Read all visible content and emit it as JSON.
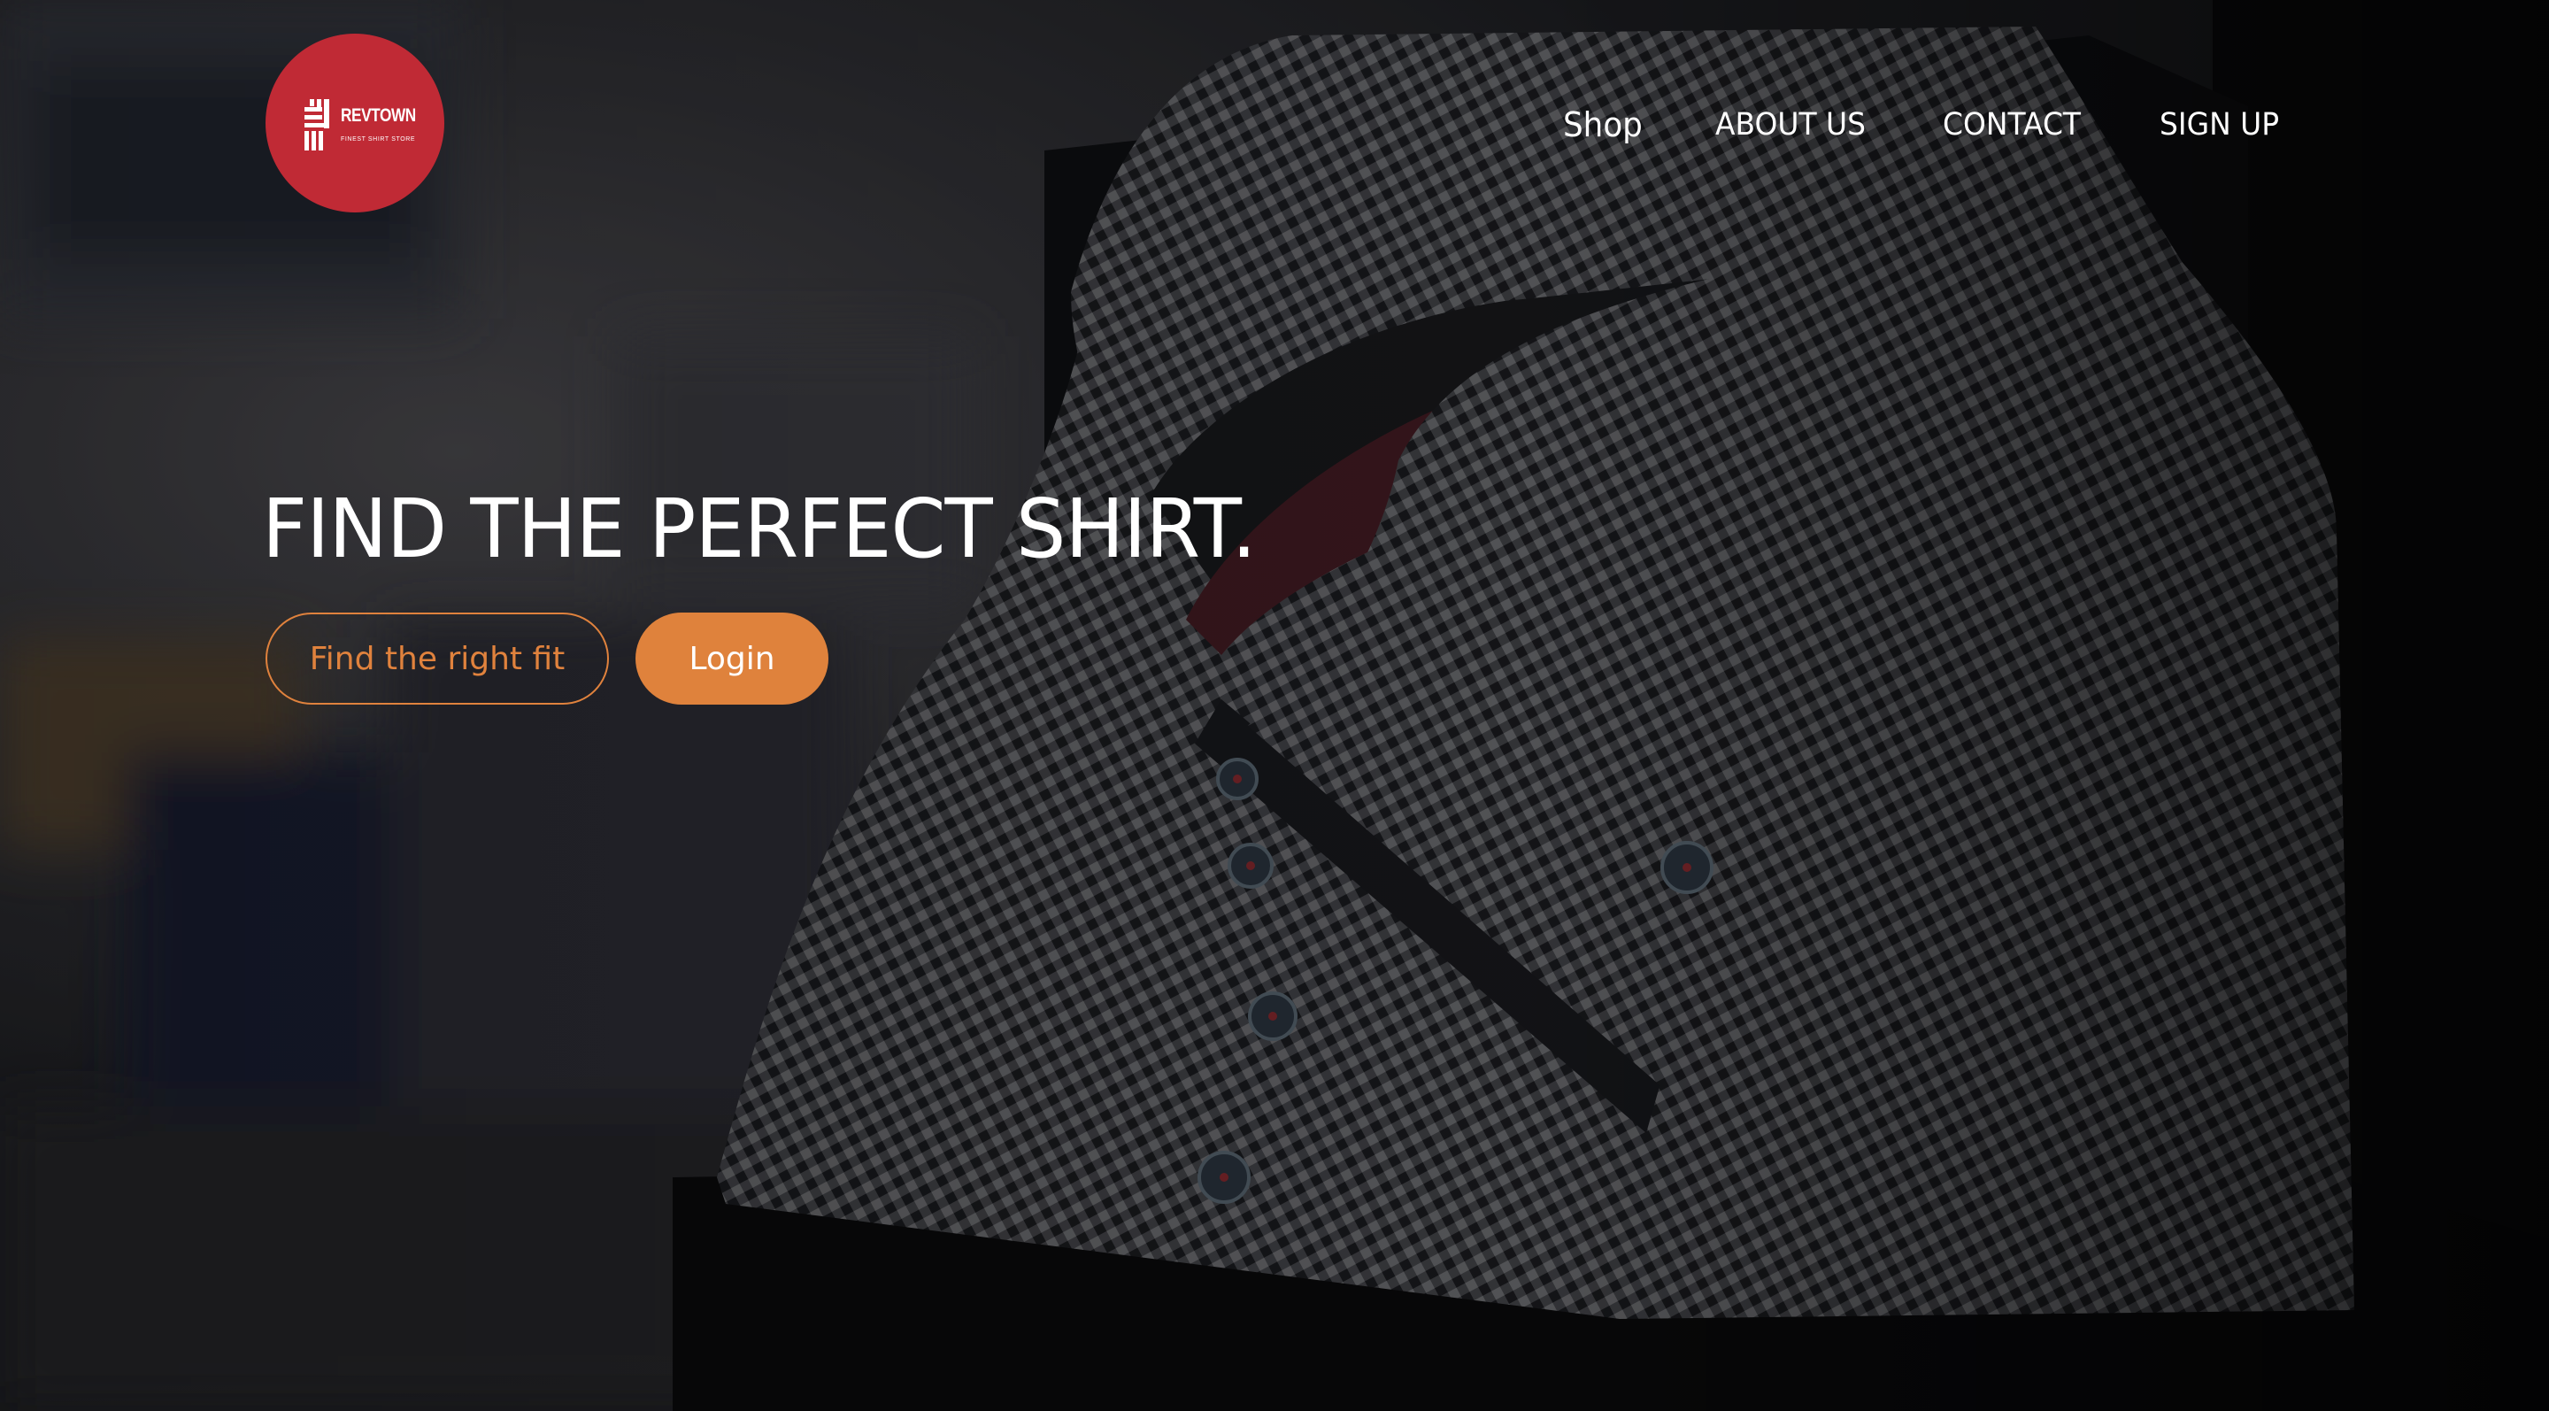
{
  "brand": {
    "name": "REVTOWN",
    "tagline": "FINEST SHIRT STORE",
    "badge_color": "#c02a35",
    "icon": "stripes-logo-icon"
  },
  "nav": {
    "shop": "Shop",
    "about": "ABOUT US",
    "contact": "CONTACT",
    "signup": "SIGN UP"
  },
  "hero": {
    "headline": "FIND THE PERFECT SHIRT.",
    "primary_cta": "Find the right fit",
    "secondary_cta": "Login",
    "accent_color": "#df823c",
    "background_image": "dark gingham shirt-collar photo"
  }
}
